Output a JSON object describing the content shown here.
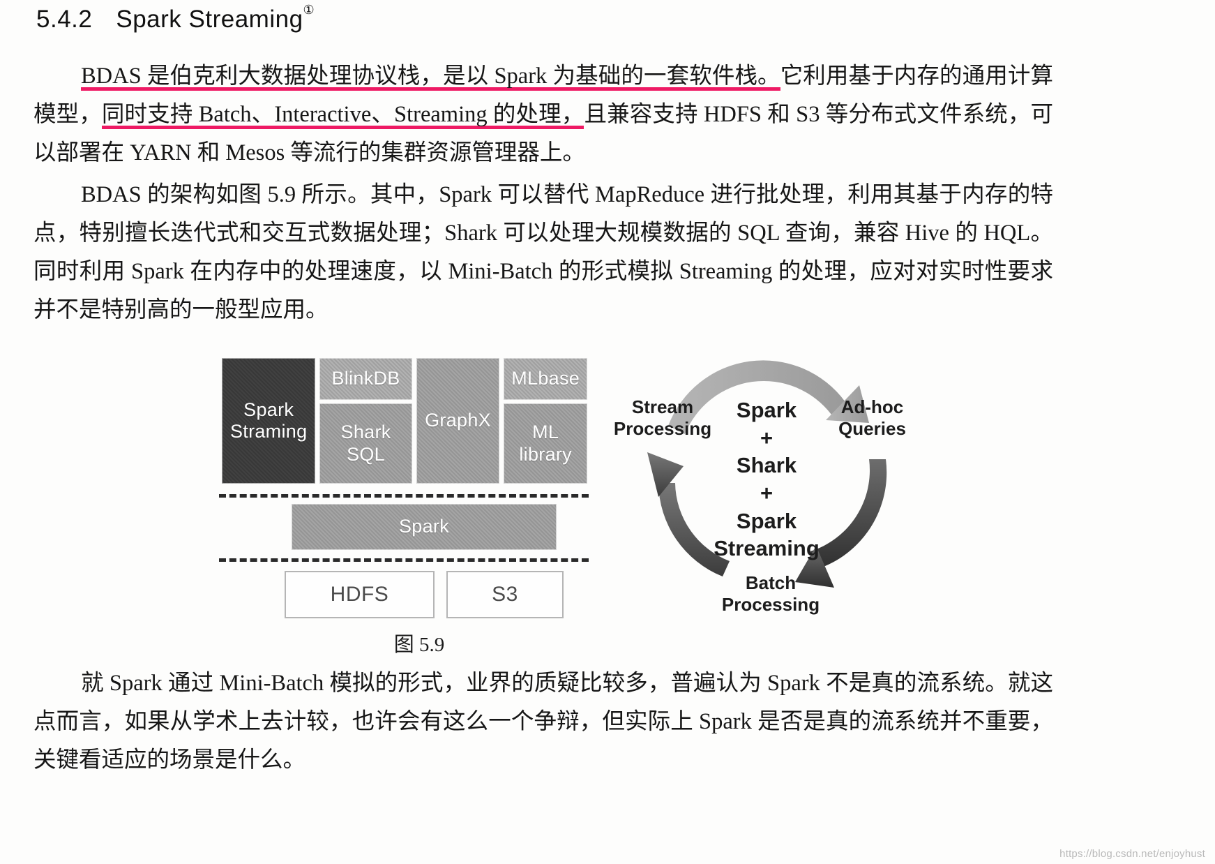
{
  "heading": {
    "number": "5.4.2",
    "title": "Spark Streaming",
    "footnote_marker": "①"
  },
  "paragraphs": {
    "p1": {
      "highlight_1": "BDAS 是伯克利大数据处理协议栈，是以 Spark 为基础的一套软件栈。",
      "rest_1": "它利用基于内存的通用计算模型，",
      "highlight_2": "同时支持 Batch、Interactive、Streaming 的处理，",
      "rest_2": "且兼容支持 HDFS 和 S3 等分布式文件系统，可以部署在 YARN 和 Mesos 等流行的集群资源管理器上。"
    },
    "p2": "BDAS 的架构如图 5.9 所示。其中，Spark 可以替代 MapReduce 进行批处理，利用其基于内存的特点，特别擅长迭代式和交互式数据处理；Shark 可以处理大规模数据的 SQL 查询，兼容 Hive 的 HQL。同时利用 Spark 在内存中的处理速度，以 Mini-Batch 的形式模拟 Streaming 的处理，应对对实时性要求并不是特别高的一般型应用。",
    "p3": "就 Spark 通过 Mini-Batch 模拟的形式，业界的质疑比较多，普遍认为 Spark 不是真的流系统。就这点而言，如果从学术上去计较，也许会有这么一个争辩，但实际上 Spark 是否是真的流系统并不重要，关键看适应的场景是什么。"
  },
  "figure": {
    "caption": "图 5.9",
    "stack": {
      "spark_streaming": "Spark\nStraming",
      "blinkdb": "BlinkDB",
      "shark_sql": "Shark\nSQL",
      "graphx": "GraphX",
      "mlbase": "MLbase",
      "ml_library": "ML\nlibrary",
      "spark_core": "Spark",
      "hdfs": "HDFS",
      "s3": "S3"
    },
    "cycle": {
      "label_stream": "Stream\nProcessing",
      "label_adhoc": "Ad-hoc\nQueries",
      "label_batch": "Batch\nProcessing",
      "center": "Spark\n+\nShark\n+\nSpark\nStreaming"
    }
  },
  "watermark": "https://blog.csdn.net/enjoyhust",
  "colors": {
    "highlight_pink": "#ee1a64",
    "box_dark": "#3a3a3a",
    "box_gray": "#9d9d9d",
    "arrow_light": "#a5a5a5",
    "arrow_dark": "#3b3b3b"
  }
}
